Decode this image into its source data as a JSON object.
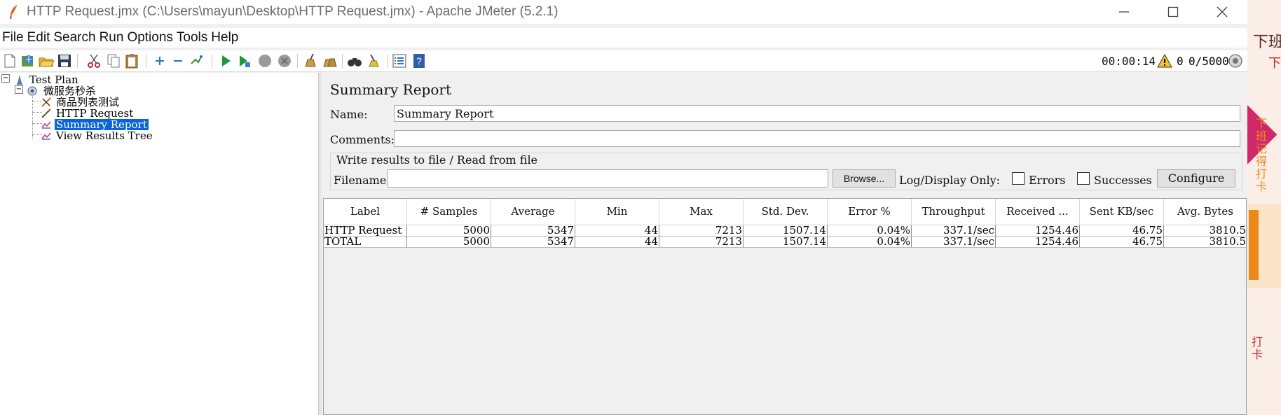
{
  "window": {
    "title": "HTTP Request.jmx (C:\\Users\\mayun\\Desktop\\HTTP Request.jmx) - Apache JMeter (5.2.1)"
  },
  "menu": [
    "File",
    "Edit",
    "Search",
    "Run",
    "Options",
    "Tools",
    "Help"
  ],
  "status": {
    "elapsed": "00:00:14",
    "warnings": "0",
    "threads": "0/5000"
  },
  "tree": {
    "items": [
      {
        "label": "Test Plan",
        "icon": "test-plan-icon"
      },
      {
        "label": "微服务秒杀",
        "icon": "thread-group-icon"
      },
      {
        "label": "商品列表测试",
        "icon": "sampler-icon"
      },
      {
        "label": "HTTP Request",
        "icon": "http-request-icon"
      },
      {
        "label": "Summary Report",
        "icon": "listener-icon",
        "selected": true
      },
      {
        "label": "View Results Tree",
        "icon": "listener-icon"
      }
    ]
  },
  "report": {
    "title": "Summary Report",
    "name_label": "Name:",
    "name_value": "Summary Report",
    "comments_label": "Comments:",
    "comments_value": "",
    "group_title": "Write results to file / Read from file",
    "filename_label": "Filename",
    "filename_value": "",
    "browse_label": "Browse...",
    "log_display_label": "Log/Display Only:",
    "errors_label": "Errors",
    "successes_label": "Successes",
    "configure_label": "Configure"
  },
  "table": {
    "columns": [
      "Label",
      "# Samples",
      "Average",
      "Min",
      "Max",
      "Std. Dev.",
      "Error %",
      "Throughput",
      "Received ...",
      "Sent KB/sec",
      "Avg. Bytes"
    ],
    "rows": [
      [
        "HTTP Request",
        "5000",
        "5347",
        "44",
        "7213",
        "1507.14",
        "0.04%",
        "337.1/sec",
        "1254.46",
        "46.75",
        "3810.5"
      ],
      [
        "TOTAL",
        "5000",
        "5347",
        "44",
        "7213",
        "1507.14",
        "0.04%",
        "337.1/sec",
        "1254.46",
        "46.75",
        "3810.5"
      ]
    ]
  },
  "background_app": {
    "fragments": [
      "下班",
      "下",
      "下班记得打卡",
      "打卡"
    ]
  },
  "colors": {
    "selection": "#0a64d6",
    "run_green": "#1a9a3a",
    "accent_orange": "#e98a1b"
  }
}
